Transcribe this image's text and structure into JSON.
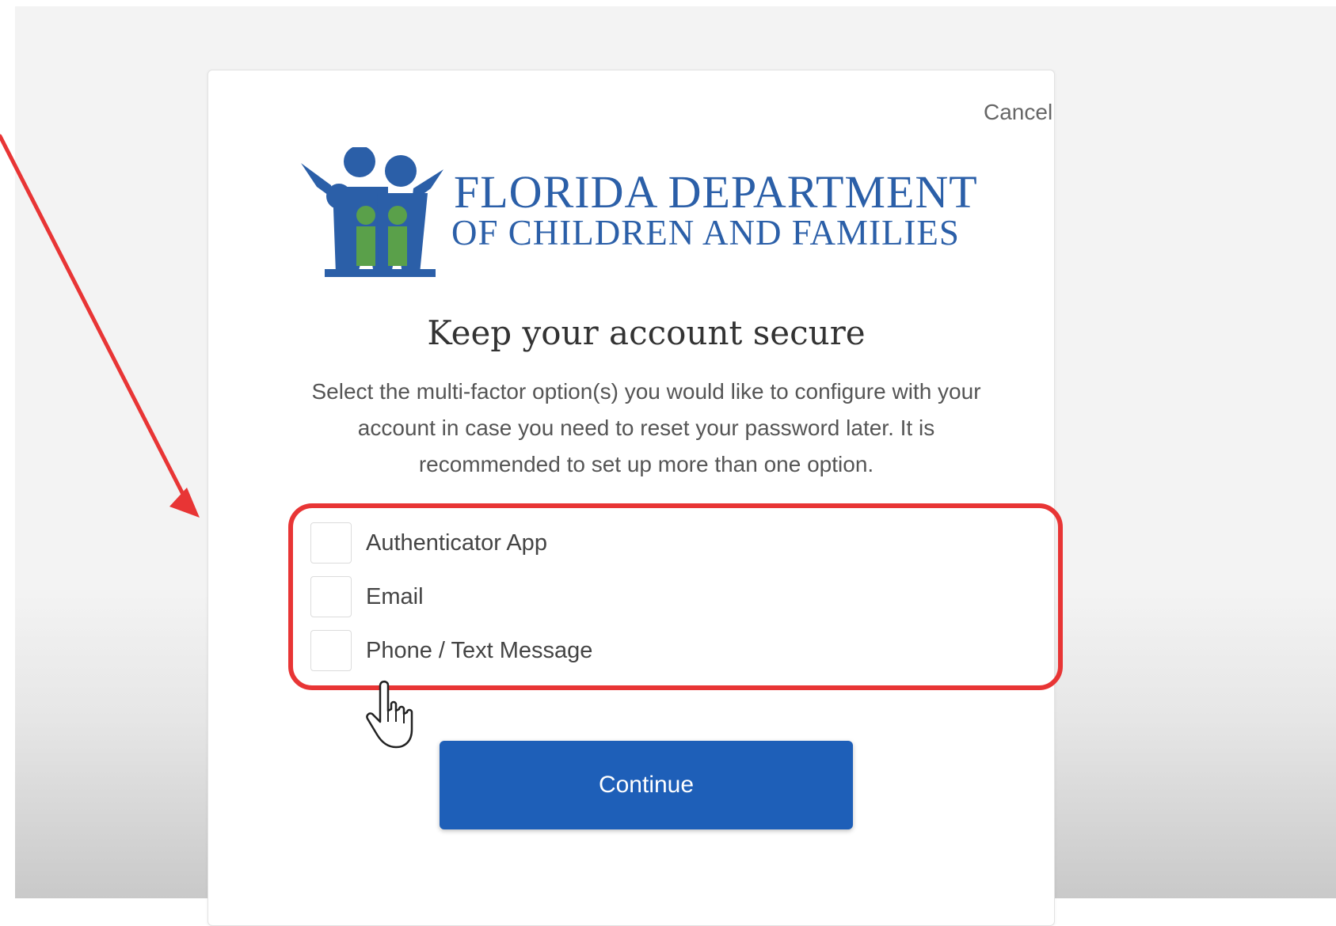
{
  "dialog": {
    "cancel_label": "Cancel",
    "title": "Keep your account secure",
    "description": "Select the multi-factor option(s) you would like to configure with your account in case you need to reset your password later. It is recommended to set up more than one option.",
    "continue_label": "Continue"
  },
  "logo": {
    "line1": "FLORIDA DEPARTMENT",
    "line2": "OF CHILDREN AND FAMILIES",
    "colors": {
      "blue": "#2b5fa8",
      "green": "#5aa04a"
    }
  },
  "options": [
    {
      "label": "Authenticator App",
      "checked": false
    },
    {
      "label": "Email",
      "checked": false
    },
    {
      "label": "Phone / Text Message",
      "checked": false
    }
  ],
  "annotations": {
    "highlight_color": "#e83535",
    "arrow_color": "#e83535"
  },
  "theme": {
    "button_color": "#1e5fb8",
    "text_color": "#555555"
  }
}
